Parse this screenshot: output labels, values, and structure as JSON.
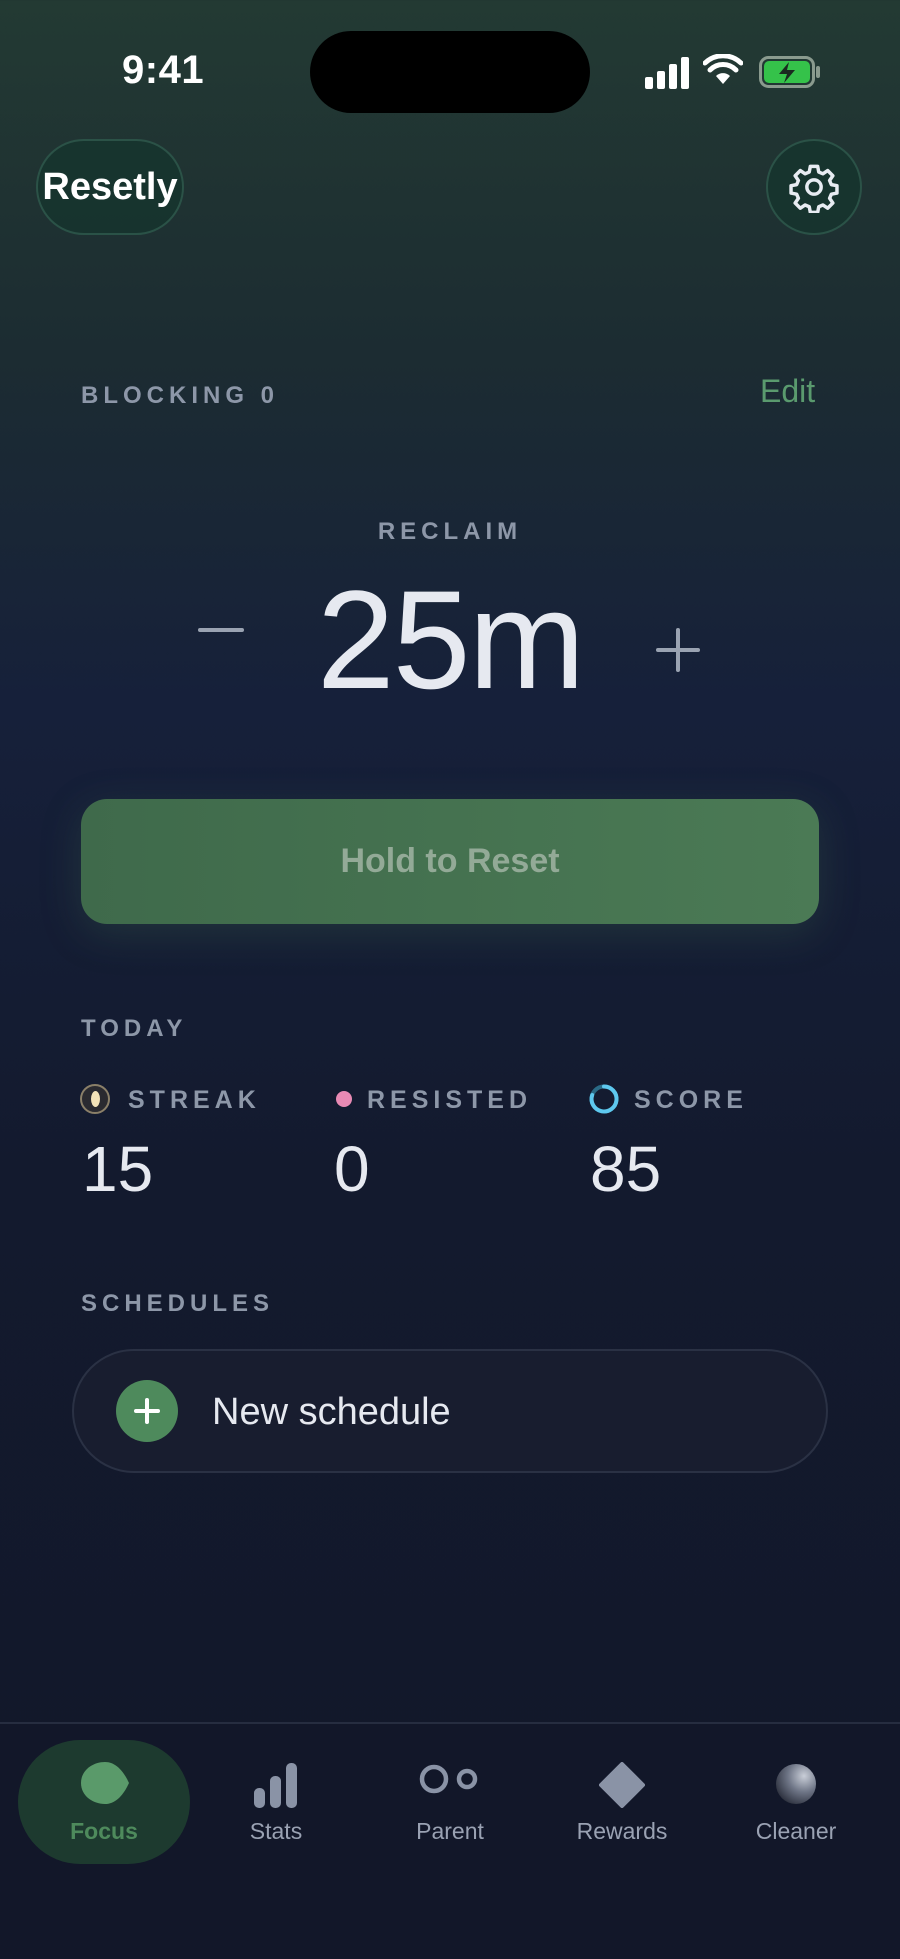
{
  "status_bar": {
    "time": "9:41"
  },
  "header": {
    "brand": "Resetly"
  },
  "blocking": {
    "label": "BLOCKING 0",
    "edit_label": "Edit"
  },
  "reclaim": {
    "label": "RECLAIM",
    "duration": "25m"
  },
  "hold_button": {
    "label": "Hold to Reset"
  },
  "today": {
    "label": "TODAY",
    "stats": [
      {
        "label": "STREAK",
        "value": "15"
      },
      {
        "label": "RESISTED",
        "value": "0"
      },
      {
        "label": "SCORE",
        "value": "85"
      }
    ]
  },
  "schedules": {
    "label": "SCHEDULES",
    "new_label": "New schedule"
  },
  "tabs": [
    {
      "label": "Focus",
      "icon": "leaf-icon",
      "active": true
    },
    {
      "label": "Stats",
      "icon": "bar-chart-icon"
    },
    {
      "label": "Parent",
      "icon": "two-circles-icon"
    },
    {
      "label": "Rewards",
      "icon": "diamond-icon"
    },
    {
      "label": "Cleaner",
      "icon": "sphere-icon"
    }
  ],
  "colors": {
    "accent": "#4e8a5c",
    "resisted": "#e88ab4",
    "score": "#5ec8ee"
  }
}
